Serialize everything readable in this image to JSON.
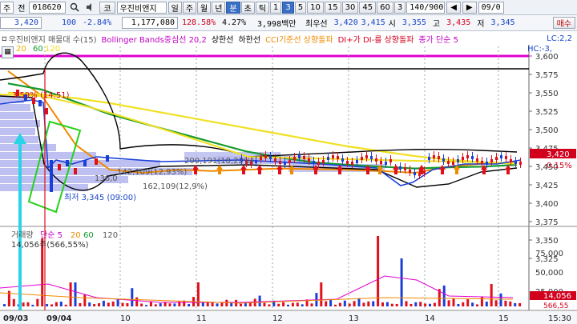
{
  "toolbar1": {
    "tab_label": "주",
    "code_label": "전",
    "code_value": "018620",
    "search_icon": "magnifier-icon",
    "exchange_label": "코",
    "stock_name": "우진비앤지",
    "periods": [
      "일",
      "주",
      "월",
      "년",
      "분",
      "초",
      "틱",
      "1",
      "3",
      "5",
      "10",
      "15",
      "30",
      "45",
      "60",
      "3"
    ],
    "active_period": "분",
    "active_interval": "3",
    "count_value": "140/900",
    "date_value": "09/0"
  },
  "toolbar2": {
    "price": "3,420",
    "change_volume": "100",
    "change_rate": "-2.84%",
    "volume": "1,177,080",
    "vol_rate": "128.58%",
    "turnover": "4.27%",
    "amount": "3,998백만",
    "best_label": "최우선",
    "ask": "3,420",
    "bid": "3,415",
    "low_label": "시",
    "low_value": "3,355",
    "high_label": "고",
    "high_value": "3,435",
    "close_label": "저",
    "close_value": "3,345",
    "trade_button": "매수"
  },
  "legend": {
    "name_text": "우진비앤지 매물대 수(15)",
    "bollinger": "Bollinger Bands중심선 20,2",
    "upper": "상한선",
    "lower": "하한선",
    "cci": "CCI기준선 상향돌파",
    "di": "DI+가 DI-를 상향돌파",
    "ma": "종가 단순 5",
    "right1": "LC:2,2",
    "right2": "HC:-3,"
  },
  "ma_labels": {
    "ma20": "20",
    "ma60": "60",
    "ma120": "120"
  },
  "annotations": {
    "high_mark": "3.59% (14:51)",
    "low_mark": "최저 3,345 (09:00)",
    "vol_profile_1": "142,109(12,93%)",
    "vol_profile_2": "200,191(18,22%)",
    "vol_profile_3": "162,109(12,9%)",
    "vol_profile_4": "136,0"
  },
  "price_axis": {
    "ticks": [
      "3,600",
      "3,575",
      "3,550",
      "3,525",
      "3,500",
      "3,475",
      "3,450",
      "3,425",
      "3,400",
      "3,375",
      "3,350",
      "3,325"
    ],
    "current_price": "3,420",
    "current_rate": "0.15%"
  },
  "volume_panel": {
    "label_main": "거래량",
    "label_ma": "단순 5",
    "ma_values": [
      "20",
      "60",
      "120"
    ],
    "volume_text": "14,056주(566,55%)",
    "axis_ticks": [
      "75,000",
      "50,000",
      "25,000"
    ],
    "current_volume": "14,056",
    "current_rate": "566,55"
  },
  "time_axis": {
    "labels": [
      "09/03",
      "09/04",
      "10",
      "11",
      "12",
      "13",
      "14",
      "15",
      "15:30"
    ]
  },
  "colors": {
    "bull": "#e0101a",
    "bear": "#1a3fd8",
    "bollinger": "#000000",
    "ma5": "#f08a00",
    "ma20": "#139a2c",
    "ma60": "#f0e020",
    "highlight": "#23d11a",
    "magenta": "#e000d0",
    "cyan": "#29d4e8"
  },
  "chart_data": {
    "type": "line",
    "ylim": [
      3325,
      3600
    ],
    "series": [
      {
        "name": "5",
        "values": [
          3560,
          3520,
          3440,
          3400,
          3395,
          3400,
          3398,
          3400,
          3402,
          3401,
          3400,
          3398,
          3395,
          3405,
          3410,
          3412
        ]
      },
      {
        "name": "20",
        "values": [
          3540,
          3530,
          3510,
          3490,
          3475,
          3460,
          3445,
          3430,
          3420,
          3412,
          3408,
          3405,
          3402,
          3404,
          3405,
          3408
        ]
      },
      {
        "name": "60",
        "values": [
          3525,
          3522,
          3516,
          3508,
          3498,
          3488,
          3478,
          3468,
          3458,
          3448,
          3438,
          3430,
          3422,
          3416,
          3412,
          3410
        ]
      }
    ],
    "volume": [
      8,
      22,
      14,
      6,
      5,
      7,
      4,
      9,
      6,
      5,
      7,
      6,
      9,
      5,
      33,
      60,
      8,
      14,
      6,
      5,
      11,
      8,
      7,
      14,
      9,
      6
    ],
    "xlabel": "",
    "ylabel": ""
  }
}
